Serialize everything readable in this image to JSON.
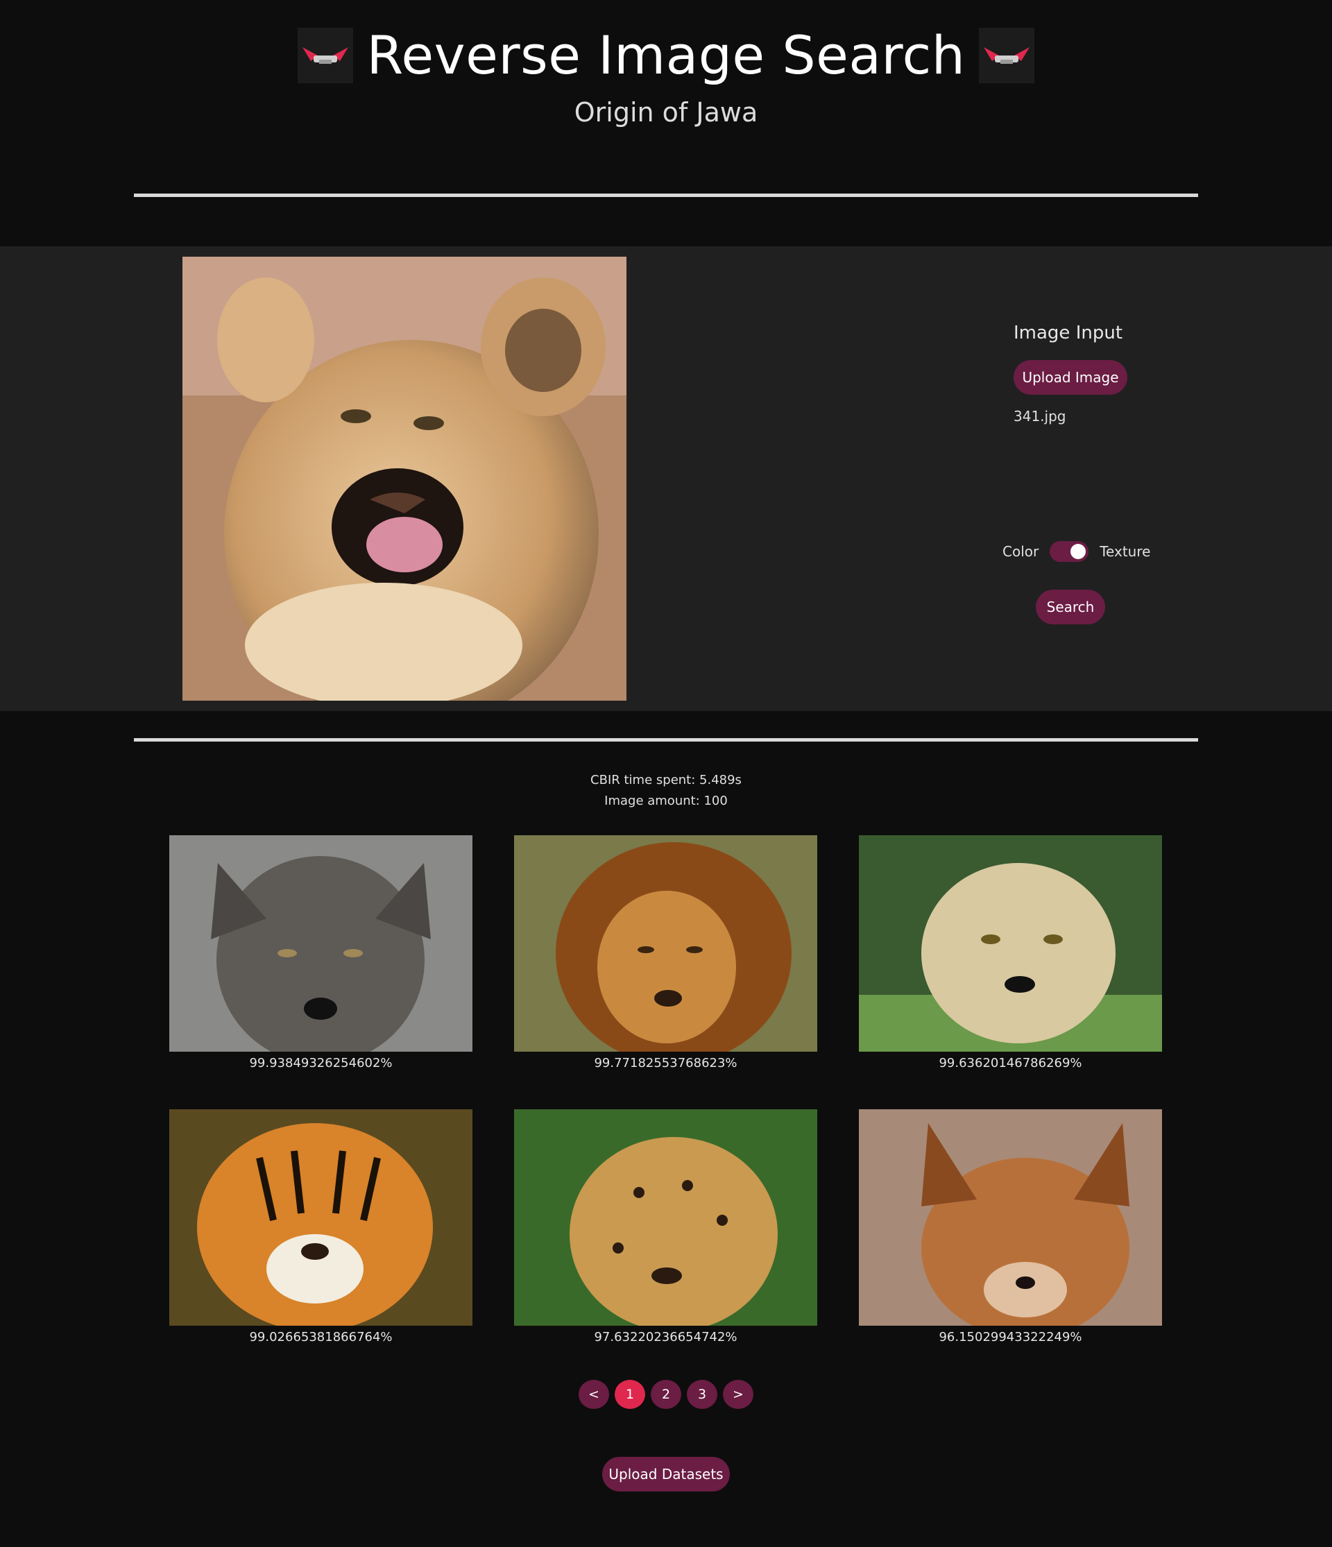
{
  "header": {
    "title": "Reverse Image Search",
    "subtitle": "Origin of Jawa",
    "logo_icon": "jawa-logo-icon"
  },
  "input_panel": {
    "label": "Image Input",
    "upload_label": "Upload Image",
    "filename": "341.jpg",
    "toggle_left": "Color",
    "toggle_right": "Texture",
    "toggle_on": true,
    "search_label": "Search"
  },
  "results": {
    "time_text": "CBIR time spent: 5.489s",
    "amount_text": "Image amount: 100",
    "items": [
      {
        "animal": "wolf",
        "score": "99.93849326254602%"
      },
      {
        "animal": "lion",
        "score": "99.77182553768623%"
      },
      {
        "animal": "cheetah",
        "score": "99.63620146786269%"
      },
      {
        "animal": "tiger",
        "score": "99.02665381866764%"
      },
      {
        "animal": "jaguar",
        "score": "97.63220236654742%"
      },
      {
        "animal": "fox",
        "score": "96.15029943322249%"
      }
    ]
  },
  "pagination": {
    "prev": "<",
    "pages": [
      "1",
      "2",
      "3"
    ],
    "active": "1",
    "next": ">"
  },
  "footer": {
    "upload_datasets_label": "Upload Datasets"
  },
  "colors": {
    "accent": "#6b1d44",
    "active_page": "#e0284f",
    "background": "#0d0d0d",
    "panel": "#202020"
  }
}
